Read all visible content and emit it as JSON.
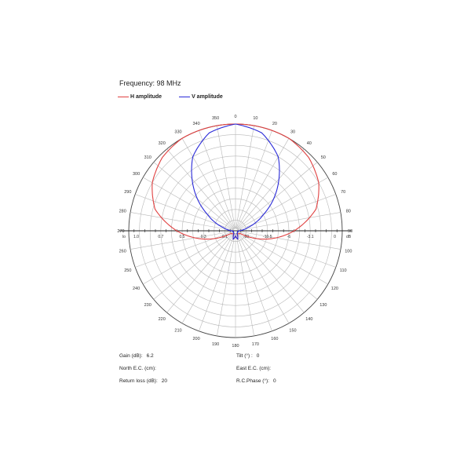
{
  "header": {
    "frequency_label": "Frequency:",
    "frequency_value": "98 MHz"
  },
  "legend": [
    {
      "label": "H amplitude",
      "color": "#e04040"
    },
    {
      "label": "V amplitude",
      "color": "#2a2ad8"
    }
  ],
  "info": {
    "gain_label": "Gain (dB):",
    "gain_value": "6.2",
    "tilt_label": "Tilt (°) :",
    "tilt_value": "0",
    "north_ec_label": "North E.C. (cm):",
    "north_ec_value": "",
    "east_ec_label": "East E.C. (cm):",
    "east_ec_value": "",
    "return_loss_label": "Return loss (dB):",
    "return_loss_value": "20",
    "rc_phase_label": "R.C.Phase (°):",
    "rc_phase_value": "0"
  },
  "chart_data": {
    "type": "polar",
    "angle_labels": [
      "0",
      "10",
      "20",
      "30",
      "40",
      "50",
      "60",
      "70",
      "80",
      "90",
      "100",
      "110",
      "120",
      "130",
      "140",
      "150",
      "160",
      "170",
      "180",
      "190",
      "200",
      "210",
      "220",
      "230",
      "240",
      "250",
      "260",
      "270",
      "280",
      "290",
      "300",
      "310",
      "320",
      "330",
      "340",
      "350"
    ],
    "left_scale": {
      "end_label": "lo",
      "ticks": [
        "1.0",
        "0.7",
        "0.5",
        "0.3",
        "0.1"
      ]
    },
    "right_scale": {
      "end_label": "dB",
      "ticks": [
        "-20",
        "-10.5",
        "-6",
        "-3.1",
        "0"
      ]
    },
    "series": [
      {
        "name": "H amplitude",
        "color": "#e04040",
        "angles_deg": [
          -180,
          -165,
          -150,
          -120,
          -90,
          -75,
          -60,
          -45,
          -30,
          -15,
          0,
          15,
          30,
          45,
          60,
          75,
          90,
          120,
          150,
          165,
          180
        ],
        "values": [
          0.05,
          0.08,
          0.03,
          0.05,
          0.55,
          0.78,
          0.9,
          0.97,
          1.0,
          1.0,
          1.0,
          1.0,
          1.0,
          0.97,
          0.9,
          0.78,
          0.55,
          0.05,
          0.03,
          0.08,
          0.05
        ]
      },
      {
        "name": "V amplitude",
        "color": "#2a2ad8",
        "angles_deg": [
          -180,
          -165,
          -150,
          -120,
          -90,
          -75,
          -60,
          -45,
          -30,
          -15,
          0,
          15,
          30,
          45,
          60,
          75,
          90,
          120,
          150,
          165,
          180
        ],
        "values": [
          0.05,
          0.08,
          0.03,
          0.02,
          0.03,
          0.12,
          0.3,
          0.55,
          0.8,
          0.95,
          1.0,
          0.95,
          0.8,
          0.55,
          0.3,
          0.12,
          0.03,
          0.02,
          0.03,
          0.08,
          0.05
        ]
      }
    ]
  }
}
